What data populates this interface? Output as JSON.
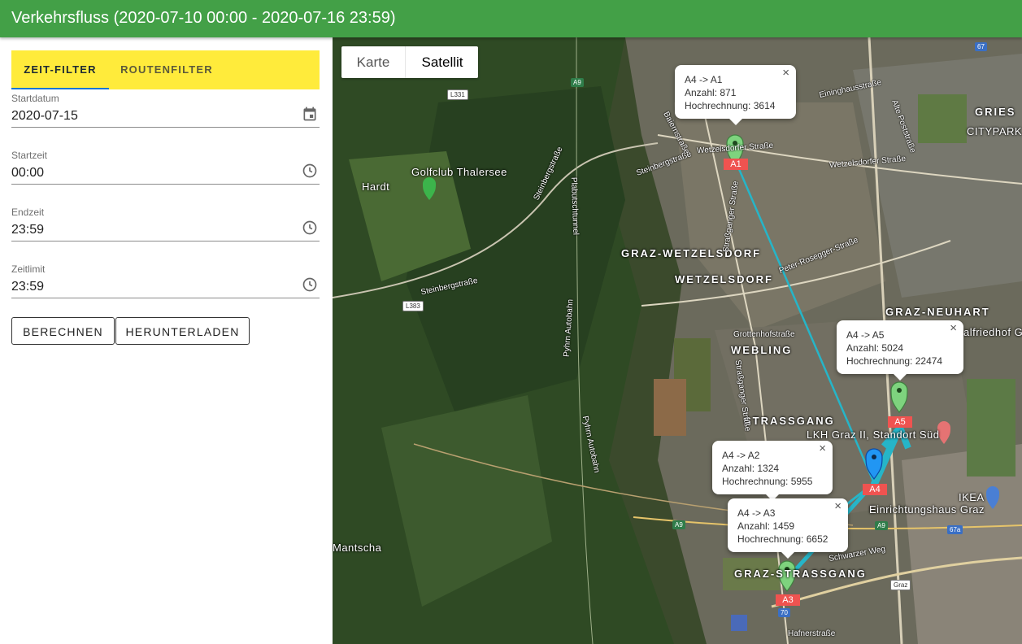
{
  "header": {
    "title": "Verkehrsfluss (2020-07-10 00:00 - 2020-07-16 23:59)"
  },
  "tabs": [
    {
      "label": "ZEIT-FILTER"
    },
    {
      "label": "ROUTENFILTER"
    }
  ],
  "fields": {
    "startdatum": {
      "label": "Startdatum",
      "value": "2020-07-15",
      "icon": "calendar-icon"
    },
    "startzeit": {
      "label": "Startzeit",
      "value": "00:00",
      "icon": "clock-icon"
    },
    "endzeit": {
      "label": "Endzeit",
      "value": "23:59",
      "icon": "clock-icon"
    },
    "zeitlimit": {
      "label": "Zeitlimit",
      "value": "23:59",
      "icon": "clock-icon"
    }
  },
  "buttons": {
    "calculate": "BERECHNEN",
    "download": "HERUNTERLADEN"
  },
  "map": {
    "type_options": [
      "Karte",
      "Satellit"
    ],
    "selected_type": "Satellit",
    "popups": [
      {
        "route": "A4 -> A1",
        "count": "Anzahl: 871",
        "projection": "Hochrechnung: 3614"
      },
      {
        "route": "A4 -> A5",
        "count": "Anzahl: 5024",
        "projection": "Hochrechnung: 22474"
      },
      {
        "route": "A4 -> A2",
        "count": "Anzahl: 1324",
        "projection": "Hochrechnung: 5955"
      },
      {
        "route": "A4 -> A3",
        "count": "Anzahl: 1459",
        "projection": "Hochrechnung: 6652"
      }
    ],
    "markers": [
      "A1",
      "A5",
      "A4",
      "A3"
    ],
    "places": {
      "griesCitypark": [
        "GRIES",
        "CITYPARK"
      ],
      "hardt": "Hardt",
      "golfclub": "Golfclub Thalersee",
      "wetzelsdorfDistrict": "GRAZ-WETZELSDORF",
      "wetzelsdorf": "WETZELSDORF",
      "neuhart": "GRAZ-NEUHART",
      "friedhof": "alfriedhof Gr",
      "webling": "WEBLING",
      "strassgang": "STRASSGANG",
      "lkh": "LKH Graz II, Standort Süd",
      "ikea": [
        "IKEA",
        "Einrichtungshaus Graz"
      ],
      "mantscha": "Mantscha",
      "grazStrassgang": "GRAZ-STRASSGANG"
    },
    "roads": {
      "steinbergstrasse": "Steinbergstraße",
      "steinbergstrasse2": "Steinbergstraße",
      "plabutschtunnel": "Plabutschtunnel",
      "pyhrn1": "Pyhrn Autobahn",
      "pyhrn2": "Pyhrn Autobahn",
      "wetzelsdorfer": "Wetzelsdorfer Straße",
      "wetzelsdorfer2": "Wetzelsdorfer Straße",
      "baiernstrasse": "Baiernstraße",
      "strassganger": "Straßganger Straße",
      "strassganger2": "Straßganger Straße",
      "roseggerstr": "Peter-Rosegger-Straße",
      "grottenhof": "Grottenhofstraße",
      "alteposta": "Alte Poststraße",
      "eininghaus": "Eininghausstraße",
      "schwarzer": "Schwarzer Weg",
      "hafner": "Hafnerstraße"
    },
    "shields": {
      "a9a": "A9",
      "a9b": "A9",
      "a9c": "A9",
      "l331": "L331",
      "l383": "L383",
      "s67": "67",
      "s67a": "67a",
      "s70": "70",
      "graz": "Graz"
    }
  }
}
